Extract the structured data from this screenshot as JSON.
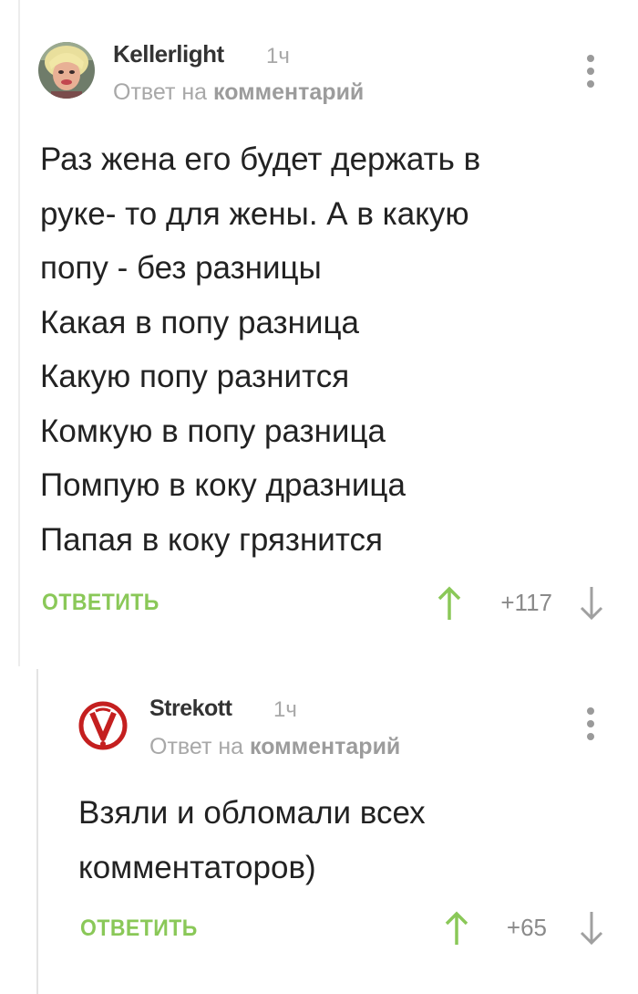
{
  "comments": [
    {
      "username": "Kellerlight",
      "time": "1ч",
      "reply_prefix": "Ответ на ",
      "reply_target": "комментарий",
      "text": "Раз жена его будет держать в\nруке- то для жены. А в какую\nпопу - без разницы\nКакая в попу разница\nКакую попу разнится\nКомкую в попу разница\nПомпую в коку дразница\nПапая в коку грязнится",
      "reply_label": "ОТВЕТИТЬ",
      "rating": "+117"
    },
    {
      "username": "Strekott",
      "time": "1ч",
      "reply_prefix": "Ответ на ",
      "reply_target": "комментарий",
      "text": "Взяли и обломали всех\nкомментаторов)",
      "reply_label": "ОТВЕТИТЬ",
      "rating": "+65"
    }
  ],
  "colors": {
    "accent_green": "#8ac858",
    "vote_up": "#8ac858",
    "vote_down": "#a0a0a0",
    "muted_text": "#a8a8a8"
  },
  "icons": {
    "avatar_1": "user-photo-avatar",
    "avatar_2": "red-logo-avatar",
    "more": "vertical-dots-icon",
    "up": "arrow-up-icon",
    "down": "arrow-down-icon"
  }
}
